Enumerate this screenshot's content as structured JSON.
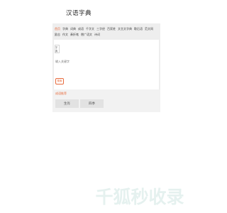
{
  "header": {
    "title": "汉语字典"
  },
  "nav": {
    "items": [
      {
        "label": "首页",
        "active": true
      },
      {
        "label": "字典"
      },
      {
        "label": "词典"
      },
      {
        "label": "成语"
      },
      {
        "label": "千字文"
      },
      {
        "label": "三字经"
      },
      {
        "label": "百家姓"
      },
      {
        "label": "文言文字典"
      },
      {
        "label": "歇后语"
      },
      {
        "label": "范文网"
      },
      {
        "label": "励志"
      },
      {
        "label": "作文"
      },
      {
        "label": "奏折笔"
      },
      {
        "label": "僧广语文"
      },
      {
        "label": "诗词"
      }
    ]
  },
  "search": {
    "type_label": "字典",
    "placeholder": "输入关键字",
    "button_label": "搜索"
  },
  "categories": [
    "汉语字典",
    "词典",
    "成语"
  ],
  "recommend": {
    "title": "成语推荐",
    "items": [
      "生肖",
      "四季"
    ]
  },
  "watermark": {
    "text": "千狐秒收录",
    "color": "#e5f1ef"
  },
  "colors": {
    "accent": "#e86a3c",
    "panel": "#eeeeee"
  }
}
